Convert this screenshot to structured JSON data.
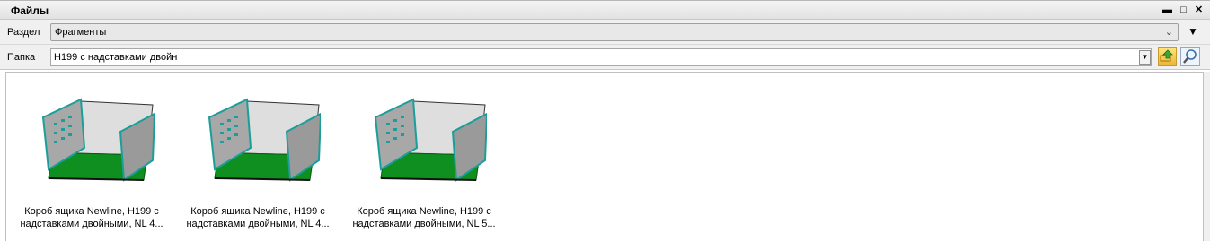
{
  "window": {
    "title": "Файлы",
    "minimize_glyph": "▬",
    "maximize_glyph": "□",
    "close_glyph": "✕"
  },
  "section": {
    "label": "Раздел",
    "value": "Фрагменты"
  },
  "folder": {
    "label": "Папка",
    "value": "H199 с надставками двойн"
  },
  "items": [
    {
      "caption_line1": "Короб ящика Newline, H199 с",
      "caption_line2": "надставками двойными, NL 4..."
    },
    {
      "caption_line1": "Короб ящика Newline, H199 с",
      "caption_line2": "надставками двойными, NL 4..."
    },
    {
      "caption_line1": "Короб ящика Newline, H199 с",
      "caption_line2": "надставками двойными, NL 5..."
    }
  ],
  "colors": {
    "accent_teal": "#1a9e9a",
    "drawer_floor": "#0f8f1f",
    "drawer_wall": "#dedede",
    "drawer_side": "#9a9a9a"
  }
}
